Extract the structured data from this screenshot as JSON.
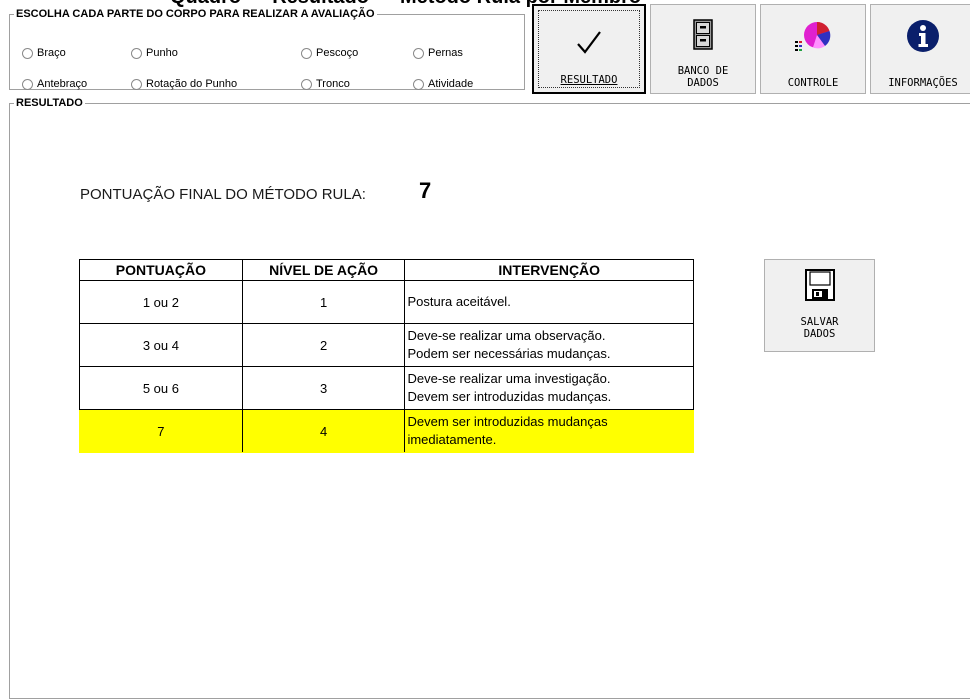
{
  "window": {
    "title_fragment": "Quadro — Resultado — Método Rula por Membro"
  },
  "choose_group": {
    "legend": "ESCOLHA CADA PARTE DO CORPO PARA REALIZAR A AVALIAÇÃO",
    "options": [
      "Braço",
      "Punho",
      "Pescoço",
      "Pernas",
      "Antebraço",
      "Rotação do Punho",
      "Tronco",
      "Atividade"
    ]
  },
  "toolbar": {
    "resultado": "RESULTADO",
    "banco_line1": "BANCO DE",
    "banco_line2": "DADOS",
    "controle": "CONTROLE",
    "informacoes": "INFORMAÇÕES",
    "icons": {
      "resultado": "checkmark-icon",
      "banco": "file-cabinet-icon",
      "controle": "pie-chart-icon",
      "info": "info-icon"
    },
    "colors": {
      "info_icon": "#0a1f6b",
      "pie_magenta": "#e020d0",
      "pie_blue": "#3030c0",
      "pie_red": "#d02030"
    }
  },
  "result_group": {
    "legend": "RESULTADO",
    "score_label": "PONTUAÇÃO FINAL DO MÉTODO RULA:",
    "score_value": "7"
  },
  "table": {
    "headers": [
      "PONTUAÇÃO",
      "NÍVEL DE AÇÃO",
      "INTERVENÇÃO"
    ],
    "rows": [
      {
        "pontuacao": "1 ou 2",
        "nivel": "1",
        "line1": "Postura aceitável.",
        "line2": ""
      },
      {
        "pontuacao": "3 ou 4",
        "nivel": "2",
        "line1": "Deve-se realizar uma observação.",
        "line2": "Podem ser necessárias mudanças."
      },
      {
        "pontuacao": "5 ou 6",
        "nivel": "3",
        "line1": "Deve-se realizar uma investigação.",
        "line2": "Devem ser introduzidas mudanças."
      },
      {
        "pontuacao": "7",
        "nivel": "4",
        "line1": "Devem ser introduzidas mudanças",
        "line2": "imediatamente."
      }
    ],
    "highlight_color": "#ffff00"
  },
  "save_button": {
    "line1": "SALVAR",
    "line2": "DADOS",
    "icon": "floppy-disk-icon"
  }
}
